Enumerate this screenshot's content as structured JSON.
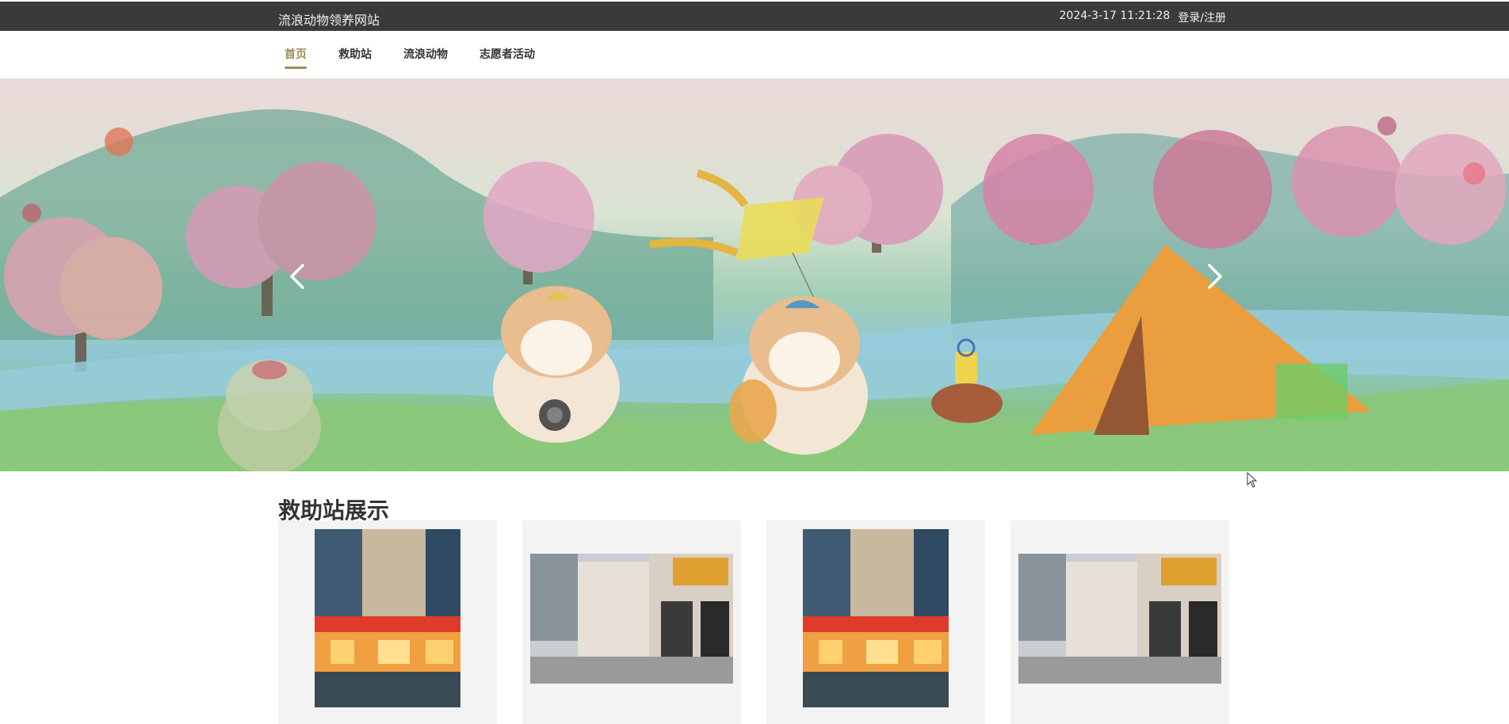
{
  "topbar": {
    "site_title": "流浪动物领养网站",
    "datetime": "2024-3-17 11:21:28",
    "login_label": "登录/注册"
  },
  "nav": {
    "items": [
      {
        "label": "首页",
        "active": true
      },
      {
        "label": "救助站",
        "active": false
      },
      {
        "label": "流浪动物",
        "active": false
      },
      {
        "label": "志愿者活动",
        "active": false
      }
    ]
  },
  "banner": {
    "icons": {
      "prev": "chevron-left-icon",
      "next": "chevron-right-icon"
    }
  },
  "section": {
    "title": "救助站展示"
  },
  "colors": {
    "topbar_bg": "#3a3a3a",
    "accent": "#a08a5a",
    "card_bg": "#f3f3f3"
  }
}
